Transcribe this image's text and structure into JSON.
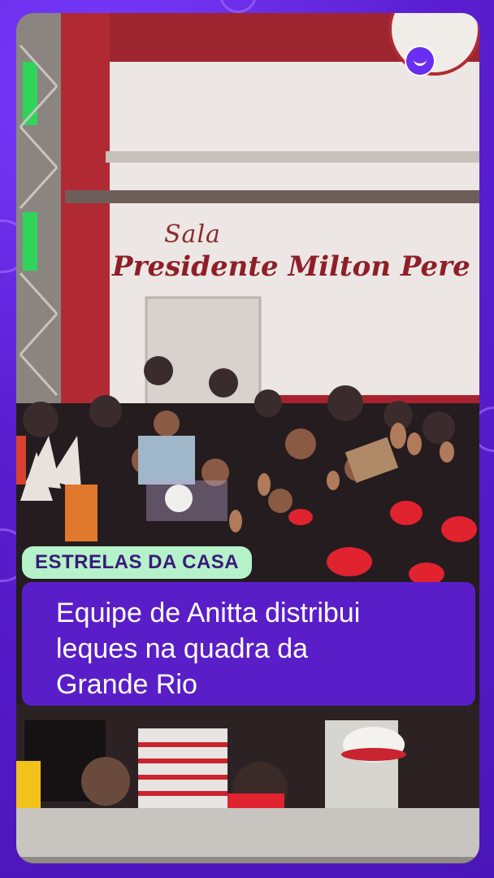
{
  "wall_sign": {
    "line1": "Sala",
    "line2": "Presidente Milton Pere"
  },
  "brand": {
    "logo_icon": "smile-logo-icon",
    "accent": "#5a1ec8",
    "tag_bg": "#b5f2c9"
  },
  "news": {
    "tag": "ESTRELAS DA CASA",
    "headline_lines": [
      "Equipe de Anitta distribui",
      "leques na quadra da",
      "Grande Rio"
    ]
  }
}
